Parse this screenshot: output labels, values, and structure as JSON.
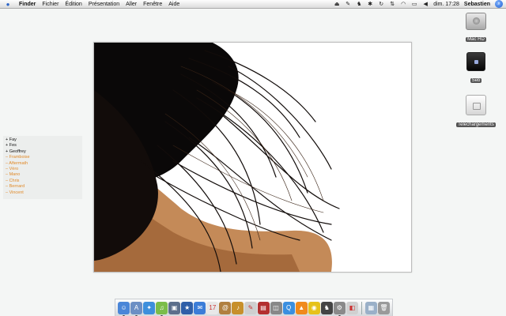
{
  "menubar": {
    "app_name": "Finder",
    "menus": [
      "Fichier",
      "Édition",
      "Présentation",
      "Aller",
      "Fenêtre",
      "Aide"
    ],
    "clock": "dim. 17:28",
    "username": "Sebastien"
  },
  "name_list": {
    "items": [
      {
        "text": "+ Fay",
        "color": "#111111"
      },
      {
        "text": "+ Fes",
        "color": "#111111"
      },
      {
        "text": "+ Geoffrey",
        "color": "#111111"
      },
      {
        "text": "– Framboise",
        "color": "#e08a2a"
      },
      {
        "text": "– Aftermath",
        "color": "#e08a2a"
      },
      {
        "text": "– Vèro",
        "color": "#e08a2a"
      },
      {
        "text": "– Mano",
        "color": "#e08a2a"
      },
      {
        "text": "– Chris",
        "color": "#e08a2a"
      },
      {
        "text": "– Bernard",
        "color": "#e08a2a"
      },
      {
        "text": "– Vincent",
        "color": "#e08a2a"
      }
    ]
  },
  "desktop_icons": {
    "hd": {
      "label": "Mac HD"
    },
    "seb": {
      "label": "Seb"
    },
    "downloads": {
      "label": "Telechargements"
    }
  },
  "dock": {
    "items": [
      {
        "name": "finder-icon",
        "color": "#4a86d8",
        "glyph": "☺",
        "running": true
      },
      {
        "name": "app-store-icon",
        "color": "#6c8fc4",
        "glyph": "A",
        "running": true
      },
      {
        "name": "safari-icon",
        "color": "#3d8fdc",
        "glyph": "✦",
        "running": false
      },
      {
        "name": "itunes-icon",
        "color": "#7bbd4a",
        "glyph": "♫",
        "running": true
      },
      {
        "name": "iphoto-icon",
        "color": "#5c6f8c",
        "glyph": "▣",
        "running": false
      },
      {
        "name": "imovie-icon",
        "color": "#2f5fa8",
        "glyph": "★",
        "running": false
      },
      {
        "name": "mail-icon",
        "color": "#3b7dd8",
        "glyph": "✉",
        "running": false
      },
      {
        "name": "calendar-icon",
        "color": "#e8e8e8",
        "glyph": "17",
        "running": false
      },
      {
        "name": "address-book-icon",
        "color": "#b08040",
        "glyph": "@",
        "running": false
      },
      {
        "name": "garageband-icon",
        "color": "#c7902c",
        "glyph": "♪",
        "running": false
      },
      {
        "name": "textedit-icon",
        "color": "#cfcfcf",
        "glyph": "✎",
        "running": false
      },
      {
        "name": "dictionary-icon",
        "color": "#b33030",
        "glyph": "▤",
        "running": false
      },
      {
        "name": "preview-icon",
        "color": "#888888",
        "glyph": "◫",
        "running": false
      },
      {
        "name": "quicktime-icon",
        "color": "#3a8fe0",
        "glyph": "Q",
        "running": false
      },
      {
        "name": "vlc-icon",
        "color": "#f08a1c",
        "glyph": "▲",
        "running": false
      },
      {
        "name": "adium-icon",
        "color": "#e6c21a",
        "glyph": "◉",
        "running": false
      },
      {
        "name": "chess-icon",
        "color": "#444444",
        "glyph": "♞",
        "running": false
      },
      {
        "name": "system-preferences-icon",
        "color": "#8a8a8a",
        "glyph": "⚙",
        "running": true
      },
      {
        "name": "utility-icon",
        "color": "#d0d0d0",
        "glyph": "◧",
        "running": false
      }
    ],
    "right_items": [
      {
        "name": "documents-stack-icon",
        "color": "#9ab0c8",
        "glyph": "▦",
        "running": false
      },
      {
        "name": "trash-icon",
        "color": "#9a9a9a",
        "glyph": "🗑",
        "running": false
      }
    ]
  }
}
